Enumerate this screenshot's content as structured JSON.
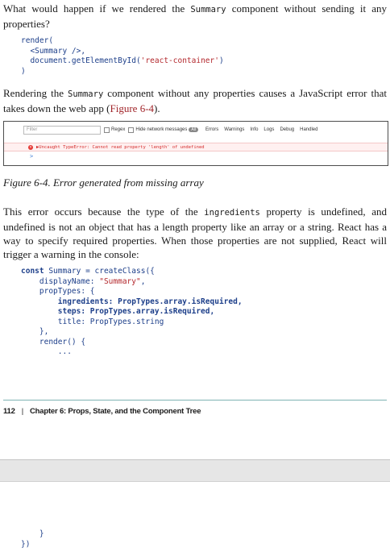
{
  "para1": {
    "before": "What would happen if we rendered the ",
    "code": "Summary",
    "after": " component without sending it any properties?"
  },
  "code1": {
    "line1": "render(",
    "line2": "  <Summary />,",
    "line3_fn": "  document.getElementById(",
    "line3_str": "'react-container'",
    "line3_end": ")",
    "line4": ")"
  },
  "para2": {
    "before": "Rendering the ",
    "code": "Summary",
    "after": " component without any properties causes a JavaScript error that takes down the web app (",
    "link": "Figure 6-4",
    "end": ")."
  },
  "console": {
    "filter_placeholder": "Filter",
    "regex": "Regex",
    "hide_network": "Hide network messages",
    "all_badge": "All",
    "levels": [
      "Errors",
      "Warnings",
      "Info",
      "Logs",
      "Debug",
      "Handled"
    ],
    "error_text": "▶Uncaught TypeError: Cannot read property 'length' of undefined",
    "prompt": ">"
  },
  "caption": "Figure 6-4. Error generated from missing array",
  "para3": {
    "before": "This error occurs because the type of the ",
    "code": "ingredients",
    "after": " property is undefined, and undefined is not an object that has a length property like an array or a string. React has a way to specify required properties. When those properties are not supplied, React will trigger a warning in the console:"
  },
  "code2": {
    "l1_kw": "const",
    "l1_rest": " Summary = createClass({",
    "l2_key": "    displayName: ",
    "l2_str": "\"Summary\"",
    "l2_end": ",",
    "l3": "    propTypes: {",
    "l4": "        ingredients: PropTypes.array.isRequired,",
    "l5": "        steps: PropTypes.array.isRequired,",
    "l6": "        title: PropTypes.string",
    "l7": "    },",
    "l8": "    render() {",
    "l9": "        ..."
  },
  "footer": {
    "page_number": "112",
    "separator": "|",
    "chapter": "Chapter 6: Props, State, and the Component Tree"
  },
  "code3": {
    "l1": "    }",
    "l2": "})"
  }
}
